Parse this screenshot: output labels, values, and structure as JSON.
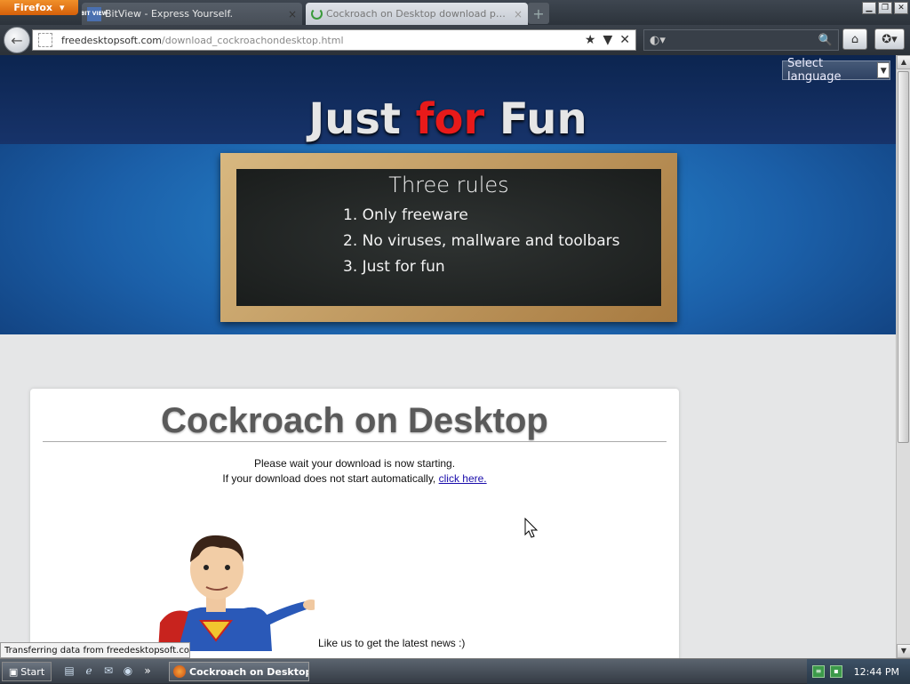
{
  "browser": {
    "menu_label": "Firefox",
    "tabs": [
      {
        "favicon": "BIT VIEW",
        "title": "BitView - Express Yourself."
      },
      {
        "title": "Cockroach on Desktop download page"
      }
    ],
    "url_domain": "freedesktopsoft.com",
    "url_path": "/download_cockroachondesktop.html",
    "status": "Transferring data from freedesktopsoft.com..."
  },
  "page": {
    "lang_select": "Select language",
    "site_title_1": "Just ",
    "site_title_2": "for",
    "site_title_3": " Fun",
    "rules_title": "Three rules",
    "rules": [
      "1. Only freeware",
      "2. No viruses, mallware and toolbars",
      "3. Just for fun"
    ],
    "heading": "Cockroach on Desktop",
    "wait_text": "Please wait your download is now starting.",
    "ifnot_text": "If your download does not start automatically,",
    "click_link": "click here.",
    "like_text": "Like us to get the latest news :)"
  },
  "taskbar": {
    "start": "Start",
    "task": "Cockroach on Desktop...",
    "clock": "12:44 PM"
  },
  "colors": {
    "accent": "#e81a1a",
    "header_blue": "#1b5fa8",
    "link": "#1a0dab"
  }
}
